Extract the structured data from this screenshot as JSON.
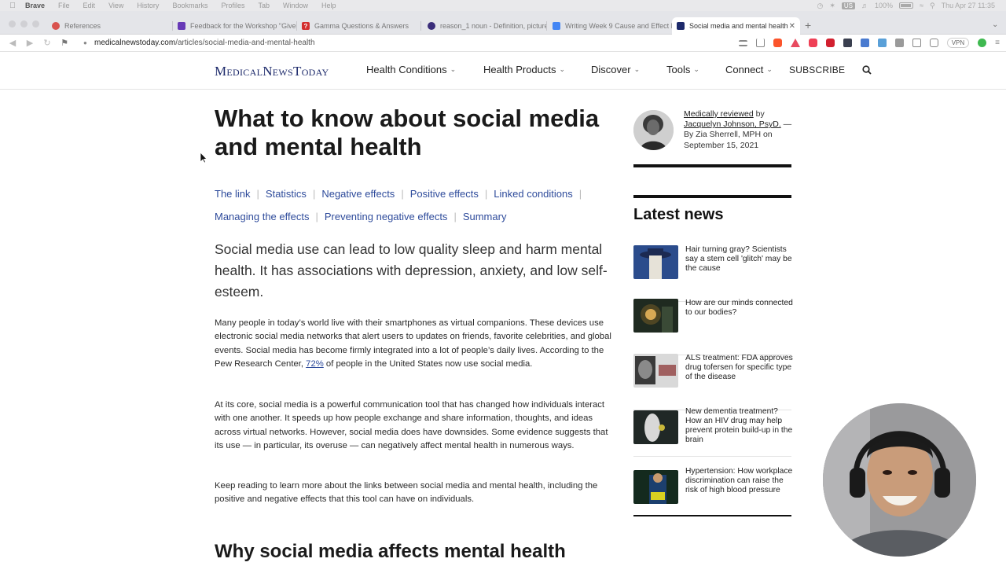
{
  "os_menubar": {
    "app": "Brave",
    "items": [
      "File",
      "Edit",
      "View",
      "History",
      "Bookmarks",
      "Profiles",
      "Tab",
      "Window",
      "Help"
    ],
    "keyboard": "US",
    "battery": "100%",
    "clock": "Thu Apr 27  11:35"
  },
  "tabs": [
    {
      "title": "References",
      "icon": "mendeley-icon",
      "color": "#d9534f"
    },
    {
      "title": "Feedback for the Workshop \"Give L",
      "icon": "forms-icon",
      "color": "#673ab7"
    },
    {
      "title": "Gamma Questions & Answers",
      "icon": "gamma-icon",
      "color": "#d32f2f"
    },
    {
      "title": "reason_1 noun - Definition, pictures",
      "icon": "oxford-icon",
      "color": "#3a2d7a"
    },
    {
      "title": "Writing Week 9 Cause and Effect Fo",
      "icon": "docs-icon",
      "color": "#4285f4"
    },
    {
      "title": "Social media and mental health",
      "icon": "mnt-icon",
      "color": "#1d2a6b"
    }
  ],
  "address_bar": {
    "host": "medicalnewstoday.com",
    "path": "/articles/social-media-and-mental-health",
    "vpn": "VPN"
  },
  "site": {
    "logo": "MedicalNewsToday",
    "nav": [
      {
        "label": "Health Conditions"
      },
      {
        "label": "Health Products"
      },
      {
        "label": "Discover"
      },
      {
        "label": "Tools"
      },
      {
        "label": "Connect"
      }
    ],
    "subscribe": "SUBSCRIBE"
  },
  "article": {
    "title": "What to know about social media and mental health",
    "toc": [
      "The link",
      "Statistics",
      "Negative effects",
      "Positive effects",
      "Linked conditions",
      "Managing the effects",
      "Preventing negative effects",
      "Summary"
    ],
    "lead": "Social media use can lead to low quality sleep and harm mental health. It has associations with depression, anxiety, and low self-esteem.",
    "p1_a": "Many people in today’s world live with their smartphones as virtual companions. These devices use electronic social media networks that alert users to updates on friends, favorite celebrities, and global events. Social media has become firmly integrated into a lot of people’s daily lives. According to the Pew Research Center, ",
    "p1_link": "72%",
    "p1_b": " of people in the United States now use social media.",
    "p2": "At its core, social media is a powerful communication tool that has changed how individuals interact with one another. It speeds up how people exchange and share information, thoughts, and ideas across virtual networks. However, social media does have downsides. Some evidence suggests that its use — in particular, its overuse — can negatively affect mental health in numerous ways.",
    "p3": "Keep reading to learn more about the links between social media and mental health, including the positive and negative effects that this tool can have on individuals.",
    "h2": "Why social media affects mental health"
  },
  "byline": {
    "reviewed": "Medically reviewed",
    "by": " by ",
    "reviewer": "Jacquelyn Johnson, PsyD.",
    "dash": " —",
    "author_line": "By Zia Sherrell, MPH on September 15, 2021"
  },
  "latest_news": {
    "heading": "Latest news",
    "items": [
      {
        "text": "Hair turning gray? Scientists say a stem cell 'glitch' may be the cause"
      },
      {
        "text": "How are our minds connected to our bodies?"
      },
      {
        "text": "ALS treatment: FDA approves drug tofersen for specific type of the disease"
      },
      {
        "text": "New dementia treatment? How an HIV drug may help prevent protein build-up in the brain"
      },
      {
        "text": "Hypertension: How workplace discrimination can raise the risk of high blood pressure"
      }
    ]
  }
}
